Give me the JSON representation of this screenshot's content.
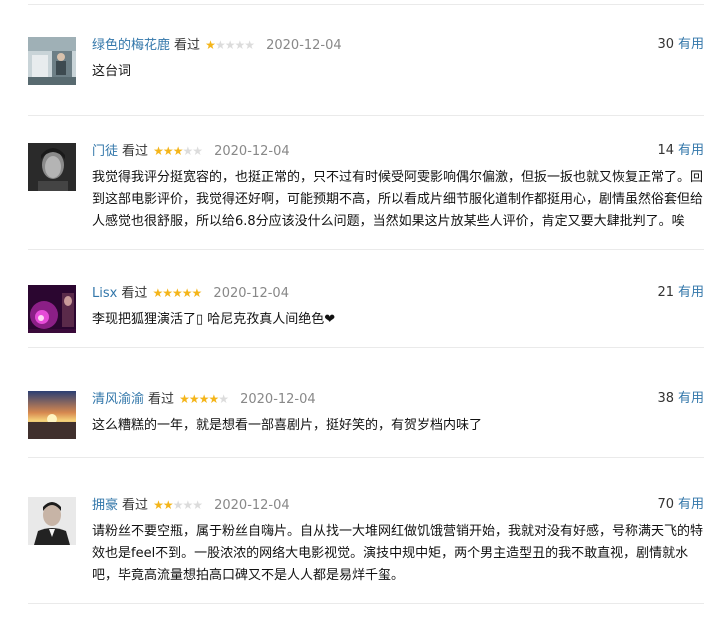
{
  "comments": [
    {
      "user": "绿色的梅花鹿",
      "watched": "看过",
      "rating": 1,
      "date": "2020-12-04",
      "votes": "30",
      "vote_label": "有用",
      "text": "这台词"
    },
    {
      "user": "门徒",
      "watched": "看过",
      "rating": 3,
      "date": "2020-12-04",
      "votes": "14",
      "vote_label": "有用",
      "text": "我觉得我评分挺宽容的，也挺正常的，只不过有时候受阿雯影响偶尔偏激，但扳一扳也就又恢复正常了。回到这部电影评价，我觉得还好啊，可能预期不高，所以看成片细节服化道制作都挺用心，剧情虽然俗套但给人感觉也很舒服，所以给6.8分应该没什么问题，当然如果这片放某些人评价，肯定又要大肆批判了。唉"
    },
    {
      "user": "Lisx",
      "watched": "看过",
      "rating": 5,
      "date": "2020-12-04",
      "votes": "21",
      "vote_label": "有用",
      "text": "李现把狐狸演活了▯ 哈尼克孜真人间绝色❤"
    },
    {
      "user": "清风渝渝",
      "watched": "看过",
      "rating": 4,
      "date": "2020-12-04",
      "votes": "38",
      "vote_label": "有用",
      "text": "这么糟糕的一年，就是想看一部喜剧片，挺好笑的，有贺岁档内味了"
    },
    {
      "user": "拥豪",
      "watched": "看过",
      "rating": 2,
      "date": "2020-12-04",
      "votes": "70",
      "vote_label": "有用",
      "text": "请粉丝不要空瓶，属于粉丝自嗨片。自从找一大堆网红做饥饿营销开始，我就对没有好感，号称满天飞的特效也是feel不到。一股浓浓的网络大电影视觉。演技中规中矩，两个男主造型丑的我不敢直视，剧情就水吧，毕竟高流量想拍高口碑又不是人人都是易烊千玺。"
    }
  ]
}
